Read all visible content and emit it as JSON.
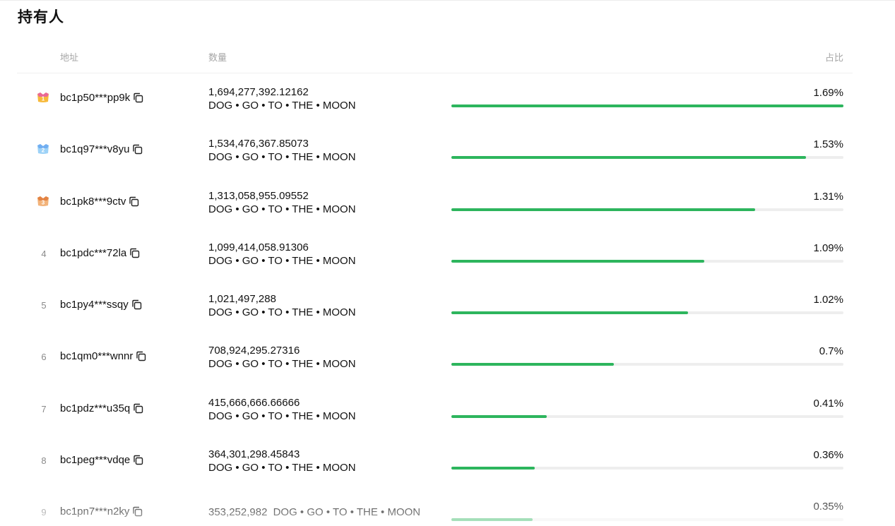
{
  "title": "持有人",
  "columns": {
    "address": "地址",
    "quantity": "数量",
    "share": "占比"
  },
  "colors": {
    "bar_fill": "#2db55d",
    "bar_track": "#eeeeee"
  },
  "holders": [
    {
      "rank": "1",
      "medal": "gold-medal-icon",
      "address": "bc1p50***pp9k",
      "amount": "1,694,277,392.12162",
      "token": "DOG • GO • TO • THE • MOON",
      "share": "1.69%",
      "share_value": 1.69
    },
    {
      "rank": "2",
      "medal": "silver-medal-icon",
      "address": "bc1q97***v8yu",
      "amount": "1,534,476,367.85073",
      "token": "DOG • GO • TO • THE • MOON",
      "share": "1.53%",
      "share_value": 1.53
    },
    {
      "rank": "3",
      "medal": "bronze-medal-icon",
      "address": "bc1pk8***9ctv",
      "amount": "1,313,058,955.09552",
      "token": "DOG • GO • TO • THE • MOON",
      "share": "1.31%",
      "share_value": 1.31
    },
    {
      "rank": "4",
      "address": "bc1pdc***72la",
      "amount": "1,099,414,058.91306",
      "token": "DOG • GO • TO • THE • MOON",
      "share": "1.09%",
      "share_value": 1.09
    },
    {
      "rank": "5",
      "address": "bc1py4***ssqy",
      "amount": "1,021,497,288",
      "token": "DOG • GO • TO • THE • MOON",
      "share": "1.02%",
      "share_value": 1.02
    },
    {
      "rank": "6",
      "address": "bc1qm0***wnnr",
      "amount": "708,924,295.27316",
      "token": "DOG • GO • TO • THE • MOON",
      "share": "0.7%",
      "share_value": 0.7
    },
    {
      "rank": "7",
      "address": "bc1pdz***u35q",
      "amount": "415,666,666.66666",
      "token": "DOG • GO • TO • THE • MOON",
      "share": "0.41%",
      "share_value": 0.41
    },
    {
      "rank": "8",
      "address": "bc1peg***vdqe",
      "amount": "364,301,298.45843",
      "token": "DOG • GO • TO • THE • MOON",
      "share": "0.36%",
      "share_value": 0.36
    },
    {
      "rank": "9",
      "address": "bc1pn7***n2ky",
      "amount": "353,252,982",
      "token": "DOG • GO • TO • THE • MOON",
      "share": "0.35%",
      "share_value": 0.35,
      "inline_amount": true
    }
  ]
}
